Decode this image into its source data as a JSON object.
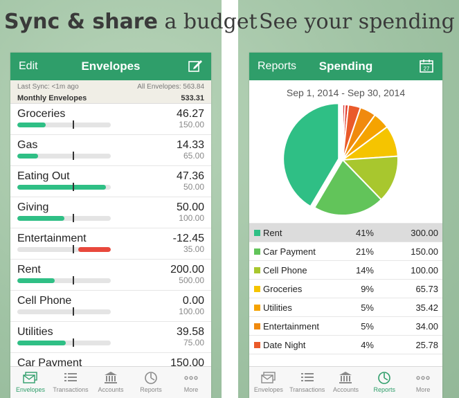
{
  "headlines": {
    "left_bold": "Sync & share",
    "left_rest": " a budget",
    "right": "See your spending"
  },
  "envelopes_screen": {
    "nav": {
      "left": "Edit",
      "title": "Envelopes",
      "right_icon": "compose-icon"
    },
    "sync": {
      "last_sync": "Last Sync: <1m ago",
      "all_envelopes": "All Envelopes: 563.84",
      "group_label": "Monthly Envelopes",
      "group_total": "533.31"
    },
    "items": [
      {
        "name": "Groceries",
        "amount": "46.27",
        "budget": "150.00",
        "fill": 0.3,
        "color": "#2fbf85"
      },
      {
        "name": "Gas",
        "amount": "14.33",
        "budget": "65.00",
        "fill": 0.22,
        "color": "#2fbf85"
      },
      {
        "name": "Eating Out",
        "amount": "47.36",
        "budget": "50.00",
        "fill": 0.95,
        "color": "#2fbf85"
      },
      {
        "name": "Giving",
        "amount": "50.00",
        "budget": "100.00",
        "fill": 0.5,
        "color": "#2fbf85"
      },
      {
        "name": "Entertainment",
        "amount": "-12.45",
        "budget": "35.00",
        "fill": 0.35,
        "color": "#e8483c",
        "overspent": true
      },
      {
        "name": "Rent",
        "amount": "200.00",
        "budget": "500.00",
        "fill": 0.4,
        "color": "#2fbf85"
      },
      {
        "name": "Cell Phone",
        "amount": "0.00",
        "budget": "100.00",
        "fill": 0.0,
        "color": "#2fbf85"
      },
      {
        "name": "Utilities",
        "amount": "39.58",
        "budget": "75.00",
        "fill": 0.52,
        "color": "#2fbf85"
      }
    ],
    "partial_row": {
      "name": "Car Payment",
      "amount": "150.00"
    },
    "tabs": [
      {
        "label": "Envelopes",
        "icon": "envelopes-icon",
        "active": true
      },
      {
        "label": "Transactions",
        "icon": "list-icon",
        "active": false
      },
      {
        "label": "Accounts",
        "icon": "bank-icon",
        "active": false
      },
      {
        "label": "Reports",
        "icon": "clock-chart-icon",
        "active": false
      },
      {
        "label": "More",
        "icon": "more-dots-icon",
        "active": false
      }
    ]
  },
  "spending_screen": {
    "nav": {
      "left": "Reports",
      "title": "Spending",
      "right_icon": "calendar-icon",
      "calendar_day": "27"
    },
    "range": "Sep 1, 2014 - Sep 30, 2014",
    "legend": [
      {
        "name": "Rent",
        "pct": "41%",
        "value": "300.00",
        "color": "#2fbf85",
        "selected": true
      },
      {
        "name": "Car Payment",
        "pct": "21%",
        "value": "150.00",
        "color": "#62c45a"
      },
      {
        "name": "Cell Phone",
        "pct": "14%",
        "value": "100.00",
        "color": "#a8c72e"
      },
      {
        "name": "Groceries",
        "pct": "9%",
        "value": "65.73",
        "color": "#f5c400"
      },
      {
        "name": "Utilities",
        "pct": "5%",
        "value": "35.42",
        "color": "#f5a300"
      },
      {
        "name": "Entertainment",
        "pct": "5%",
        "value": "34.00",
        "color": "#f08a0e"
      },
      {
        "name": "Date Night",
        "pct": "4%",
        "value": "25.78",
        "color": "#ea5a2a"
      }
    ],
    "extra_slices": [
      {
        "value": 7,
        "color": "#e33b2b"
      },
      {
        "value": 5,
        "color": "#d62828"
      }
    ],
    "tabs": [
      {
        "label": "Envelopes",
        "icon": "envelopes-icon",
        "active": false
      },
      {
        "label": "Transactions",
        "icon": "list-icon",
        "active": false
      },
      {
        "label": "Accounts",
        "icon": "bank-icon",
        "active": false
      },
      {
        "label": "Reports",
        "icon": "clock-chart-icon",
        "active": true
      },
      {
        "label": "More",
        "icon": "more-dots-icon",
        "active": false
      }
    ]
  },
  "colors": {
    "brand_green": "#2f9e6a",
    "bar_green": "#2fbf85",
    "overspent_red": "#e8483c"
  }
}
